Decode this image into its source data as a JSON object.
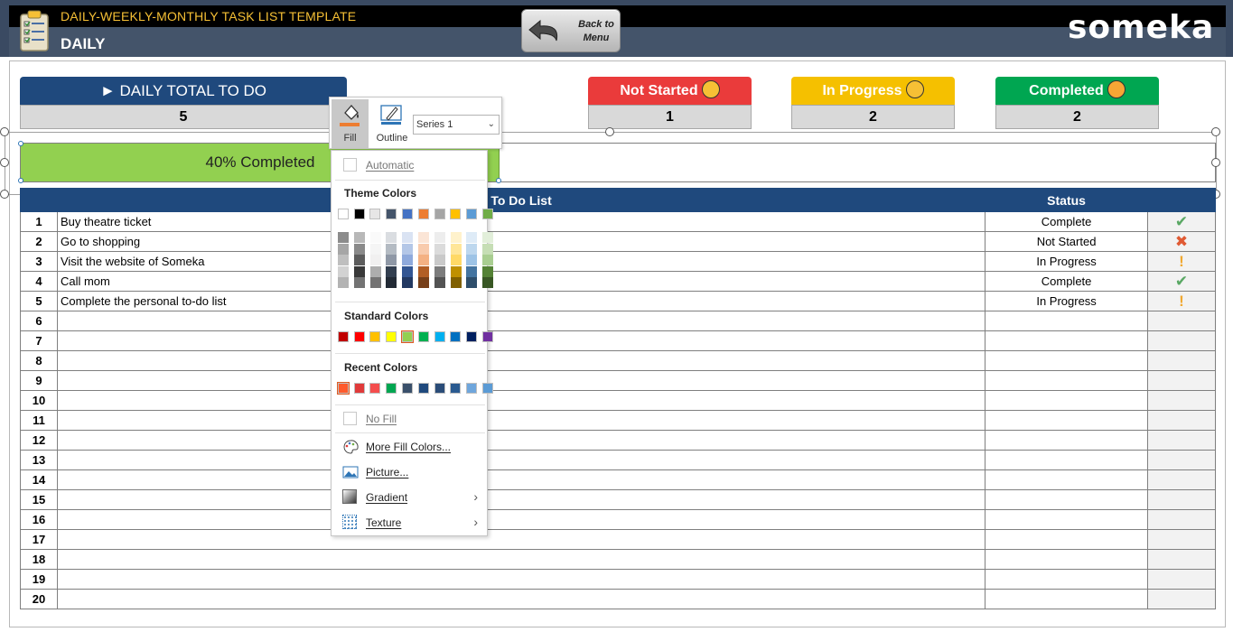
{
  "header": {
    "app_title": "DAILY-WEEKLY-MONTHLY TASK LIST TEMPLATE",
    "page_title": "DAILY",
    "back_button": "Back to\nMenu",
    "brand": "someka"
  },
  "summary": {
    "total_label": "► DAILY TOTAL TO DO",
    "total_value": "5",
    "not_started_label": "Not Started",
    "not_started_value": "1",
    "in_progress_label": "In Progress",
    "in_progress_value": "2",
    "completed_label": "Completed",
    "completed_value": "2"
  },
  "progress": {
    "text": "40% Completed",
    "fraction": 0.4
  },
  "table": {
    "header_todo": "To Do List",
    "header_status": "Status",
    "rows": [
      {
        "num": "1",
        "task": "Buy theatre ticket",
        "status": "Complete",
        "icon": "check-icon"
      },
      {
        "num": "2",
        "task": "Go to shopping",
        "status": "Not Started",
        "icon": "cross-icon"
      },
      {
        "num": "3",
        "task": "Visit the website of Someka",
        "status": "In Progress",
        "icon": "exclamation-icon"
      },
      {
        "num": "4",
        "task": "Call mom",
        "status": "Complete",
        "icon": "check-icon"
      },
      {
        "num": "5",
        "task": "Complete the personal to-do list",
        "status": "In Progress",
        "icon": "exclamation-icon"
      },
      {
        "num": "6",
        "task": "",
        "status": "",
        "icon": ""
      },
      {
        "num": "7",
        "task": "",
        "status": "",
        "icon": ""
      },
      {
        "num": "8",
        "task": "",
        "status": "",
        "icon": ""
      },
      {
        "num": "9",
        "task": "",
        "status": "",
        "icon": ""
      },
      {
        "num": "10",
        "task": "",
        "status": "",
        "icon": ""
      },
      {
        "num": "11",
        "task": "",
        "status": "",
        "icon": ""
      },
      {
        "num": "12",
        "task": "",
        "status": "",
        "icon": ""
      },
      {
        "num": "13",
        "task": "",
        "status": "",
        "icon": ""
      },
      {
        "num": "14",
        "task": "",
        "status": "",
        "icon": ""
      },
      {
        "num": "15",
        "task": "",
        "status": "",
        "icon": ""
      },
      {
        "num": "16",
        "task": "",
        "status": "",
        "icon": ""
      },
      {
        "num": "17",
        "task": "",
        "status": "",
        "icon": ""
      },
      {
        "num": "18",
        "task": "",
        "status": "",
        "icon": ""
      },
      {
        "num": "19",
        "task": "",
        "status": "",
        "icon": ""
      },
      {
        "num": "20",
        "task": "",
        "status": "",
        "icon": ""
      }
    ]
  },
  "mini_toolbar": {
    "fill_label": "Fill",
    "outline_label": "Outline",
    "series_value": "Series 1"
  },
  "fill_menu": {
    "automatic": "Automatic",
    "theme_colors": "Theme Colors",
    "standard_colors": "Standard Colors",
    "recent_colors": "Recent Colors",
    "no_fill": "No Fill",
    "more_fill_colors": "More Fill Colors...",
    "picture": "Picture...",
    "gradient": "Gradient",
    "texture": "Texture",
    "theme_row": [
      "#ffffff",
      "#000000",
      "#e7e6e6",
      "#44546a",
      "#4472c4",
      "#ed7d31",
      "#a5a5a5",
      "#ffc000",
      "#5b9bd5",
      "#70ad47"
    ],
    "standard_row": [
      "#c00000",
      "#ff0000",
      "#ffc000",
      "#ffff00",
      "#92d050",
      "#00b050",
      "#00b0f0",
      "#0070c0",
      "#002060",
      "#7030a0"
    ],
    "recent_row": [
      "#ff5a2c",
      "#e03a3a",
      "#f44d4d",
      "#00a651",
      "#3a506b",
      "#1f497d",
      "#2a4c78",
      "#2a5a90",
      "#6fa6dc",
      "#5b9bd5"
    ]
  },
  "colors": {
    "header_blue": "#1f497d",
    "not_started": "#ea3b3b",
    "in_progress": "#f5c000",
    "completed": "#00a651",
    "progress_fill": "#92d050"
  }
}
